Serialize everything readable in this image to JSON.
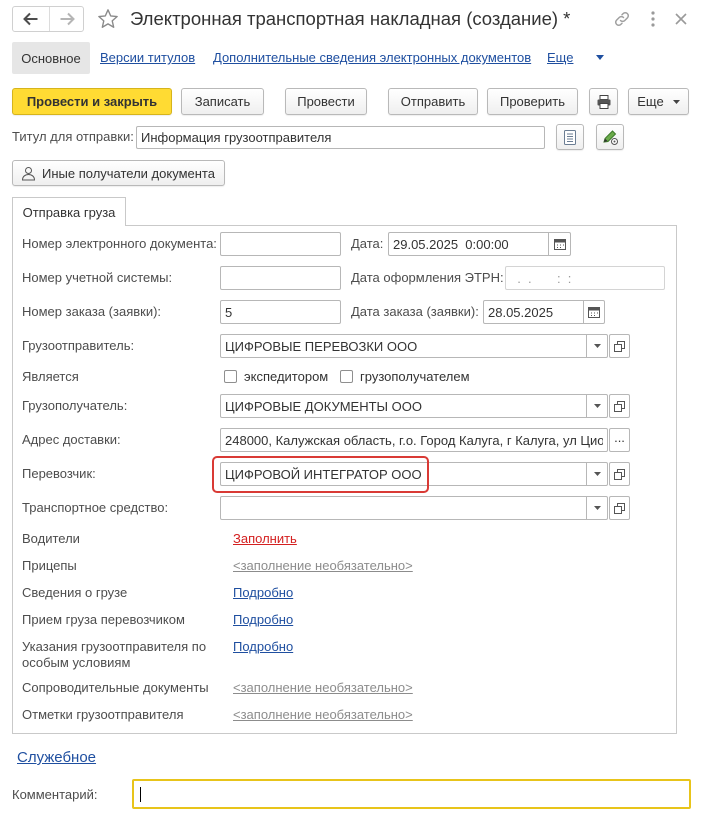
{
  "colors": {
    "accent": "#ffdb33",
    "link": "#1f4fa0",
    "link_red": "#d42020",
    "link_gray": "#8c8c8c",
    "highlight": "#d93a35",
    "focus": "#e8c41a"
  },
  "window": {
    "title": "Электронная транспортная накладная (создание) *",
    "icons": {
      "back": "arrow-left-icon",
      "forward": "arrow-right-icon",
      "favorite": "star-icon",
      "link": "link-icon",
      "menu": "more-vertical-icon",
      "close": "close-icon"
    }
  },
  "tabs": {
    "main": "Основное",
    "title_versions": "Версии титулов",
    "additional_info": "Дополнительные сведения электронных документов",
    "more": "Еще"
  },
  "toolbar": {
    "post_and_close": "Провести и закрыть",
    "save": "Записать",
    "post": "Провести",
    "send": "Отправить",
    "check": "Проверить",
    "print_icon": "printer-icon",
    "more": "Еще"
  },
  "title_for_sending": {
    "label": "Титул для отправки:",
    "value": "Информация грузоотправителя",
    "list_icon": "list-icon",
    "edit_icon": "edit-icon"
  },
  "other_recipients": {
    "label": "Иные получатели документа",
    "icon": "person-icon"
  },
  "shipment": {
    "tab_label": "Отправка груза",
    "electronic_doc_number": {
      "label": "Номер электронного документа:",
      "value": ""
    },
    "date": {
      "label": "Дата:",
      "value": "29.05.2025  0:00:00"
    },
    "accounting_system_number": {
      "label": "Номер учетной системы:",
      "value": ""
    },
    "etrn_date": {
      "label": "Дата оформления ЭТРН:",
      "value": "  .  .       :  :"
    },
    "order_number": {
      "label": "Номер заказа (заявки):",
      "value": "5"
    },
    "order_date": {
      "label": "Дата заказа (заявки):",
      "value": "28.05.2025"
    },
    "shipper": {
      "label": "Грузоотправитель:",
      "value": "ЦИФРОВЫЕ ПЕРЕВОЗКИ ООО"
    },
    "role": {
      "label": "Является",
      "options": [
        {
          "label": "экспедитором",
          "checked": false
        },
        {
          "label": "грузополучателем",
          "checked": false
        }
      ]
    },
    "consignee": {
      "label": "Грузополучатель:",
      "value": "ЦИФРОВЫЕ ДОКУМЕНТЫ ООО"
    },
    "delivery_address": {
      "label": "Адрес доставки:",
      "value": "248000, Калужская область, г.о. Город Калуга, г Калуга, ул Цио",
      "select_button": "..."
    },
    "carrier": {
      "label": "Перевозчик:",
      "value": "ЦИФРОВОЙ ИНТЕГРАТОР ООО"
    },
    "vehicle": {
      "label": "Транспортное средство:",
      "value": ""
    },
    "details": [
      {
        "label": "Водители",
        "link": "Заполнить"
      },
      {
        "label": "Прицепы",
        "link": "<заполнение необязательно>"
      },
      {
        "label": "Сведения о грузе",
        "link": "Подробно"
      },
      {
        "label": "Прием груза перевозчиком",
        "link": "Подробно"
      },
      {
        "label": "Указания грузоотправителя по особым условиям",
        "link": "Подробно"
      },
      {
        "label": "Сопроводительные документы",
        "link": "<заполнение необязательно>"
      },
      {
        "label": "Отметки грузоотправителя",
        "link": "<заполнение необязательно>"
      }
    ]
  },
  "service_link": "Служебное",
  "comment": {
    "label": "Комментарий:",
    "value": ""
  }
}
